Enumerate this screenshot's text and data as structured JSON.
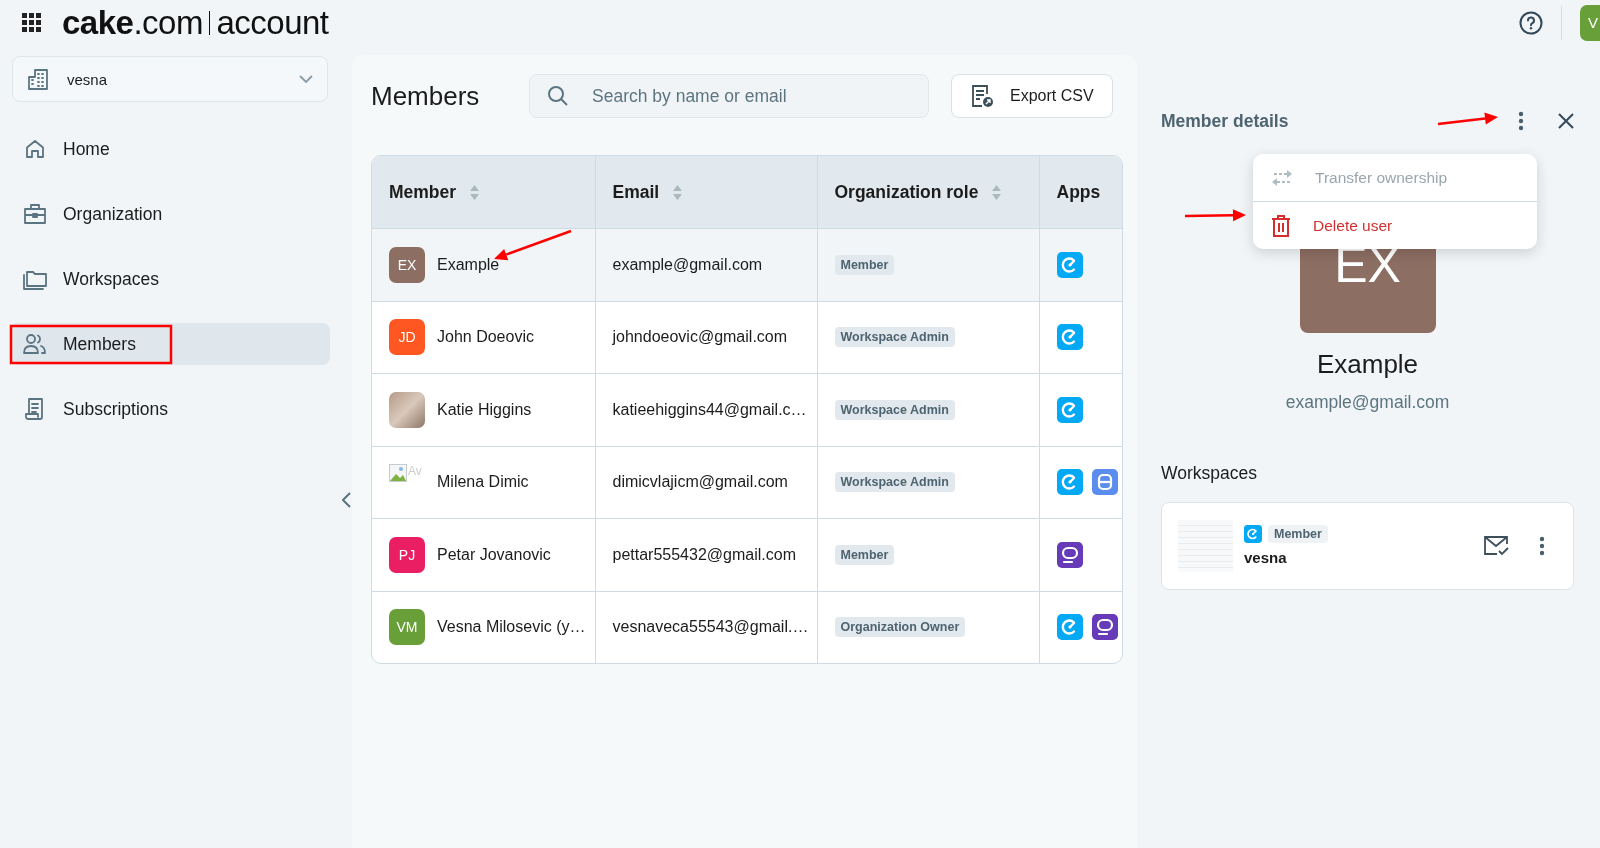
{
  "header": {
    "logo_bold": "cake",
    "logo_rest": ".com",
    "logo_product": "account",
    "user_initials": "V"
  },
  "sidebar": {
    "organization": "vesna",
    "items": [
      {
        "label": "Home",
        "selected": false
      },
      {
        "label": "Organization",
        "selected": false
      },
      {
        "label": "Workspaces",
        "selected": false
      },
      {
        "label": "Members",
        "selected": true
      },
      {
        "label": "Subscriptions",
        "selected": false
      }
    ]
  },
  "main": {
    "title": "Members",
    "search": {
      "placeholder": "Search by name or email"
    },
    "export_button": "Export CSV",
    "table": {
      "columns": [
        {
          "label": "Member",
          "sortable": true
        },
        {
          "label": "Email",
          "sortable": true
        },
        {
          "label": "Organization role",
          "sortable": true
        },
        {
          "label": "Apps",
          "sortable": false
        }
      ],
      "rows": [
        {
          "avatar": {
            "kind": "initials",
            "text": "EX",
            "color": "#8d6e63"
          },
          "name": "Example",
          "email": "example@gmail.com",
          "role": "Member",
          "apps": [
            {
              "kind": "clock"
            }
          ],
          "selected": true
        },
        {
          "avatar": {
            "kind": "initials",
            "text": "JD",
            "color": "#ff5722"
          },
          "name": "John Doeovic",
          "email": "johndoeovic@gmail.com",
          "role": "Workspace Admin",
          "apps": [
            {
              "kind": "clock"
            }
          ],
          "selected": false
        },
        {
          "avatar": {
            "kind": "photo"
          },
          "name": "Katie Higgins",
          "email": "katieehiggins44@gmail.c…",
          "role": "Workspace Admin",
          "apps": [
            {
              "kind": "clock"
            }
          ],
          "selected": false
        },
        {
          "avatar": {
            "kind": "broken",
            "text": "Av"
          },
          "name": "Milena Dimic",
          "email": "dimicvlajicm@gmail.com",
          "role": "Workspace Admin",
          "apps": [
            {
              "kind": "clock"
            },
            {
              "kind": "board"
            }
          ],
          "selected": false
        },
        {
          "avatar": {
            "kind": "initials",
            "text": "PJ",
            "color": "#e91e63"
          },
          "name": "Petar Jovanovic",
          "email": "pettar555432@gmail.com",
          "role": "Member",
          "apps": [
            {
              "kind": "chat"
            }
          ],
          "selected": false
        },
        {
          "avatar": {
            "kind": "initials",
            "text": "VM",
            "color": "#689f38"
          },
          "name": "Vesna Milosevic (y…",
          "email": "vesnaveca55543@gmail.…",
          "role": "Organization Owner",
          "apps": [
            {
              "kind": "clock"
            },
            {
              "kind": "chat"
            }
          ],
          "selected": false
        }
      ]
    }
  },
  "details": {
    "title": "Member details",
    "menu": [
      {
        "label": "Transfer ownership",
        "disabled": true,
        "destructive": false
      },
      {
        "label": "Delete user",
        "disabled": false,
        "destructive": true
      }
    ],
    "avatar": {
      "text": "EX",
      "color": "#8d6e63"
    },
    "name": "Example",
    "email": "example@gmail.com",
    "workspaces_title": "Workspaces",
    "workspaces": [
      {
        "app": {
          "kind": "clock"
        },
        "role": "Member",
        "name": "vesna"
      }
    ]
  }
}
